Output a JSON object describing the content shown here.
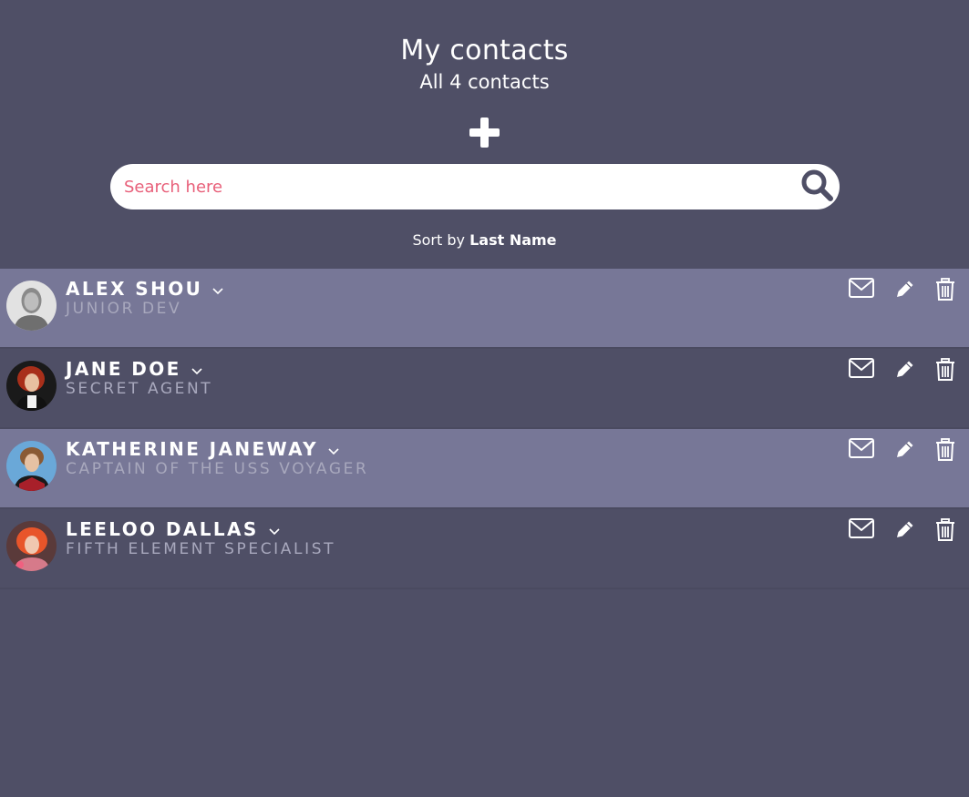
{
  "header": {
    "title": "My contacts",
    "subtitle": "All 4 contacts"
  },
  "add_icon": "plus-icon",
  "search": {
    "placeholder": "Search here",
    "value": "",
    "icon": "search-icon"
  },
  "sort": {
    "prefix": "Sort by",
    "value": "Last Name"
  },
  "contacts": [
    {
      "name": "Alex Shou",
      "role": "Junior Dev",
      "avatar": "default-user-avatar",
      "highlighted": true
    },
    {
      "name": "Jane Doe",
      "role": "Secret Agent",
      "avatar": "red-hair-portrait",
      "highlighted": false
    },
    {
      "name": "Katherine Janeway",
      "role": "Captain of the USS Voyager",
      "avatar": "uniform-portrait",
      "highlighted": true
    },
    {
      "name": "Leeloo Dallas",
      "role": "Fifth Element Specialist",
      "avatar": "orange-hair-portrait",
      "highlighted": false
    }
  ],
  "row_actions": [
    "envelope-icon",
    "pencil-icon",
    "trash-icon"
  ],
  "colors": {
    "background": "#4f4f66",
    "row_highlight": "#777797",
    "placeholder": "#e8607a",
    "role_text": "#a8a8bd"
  }
}
